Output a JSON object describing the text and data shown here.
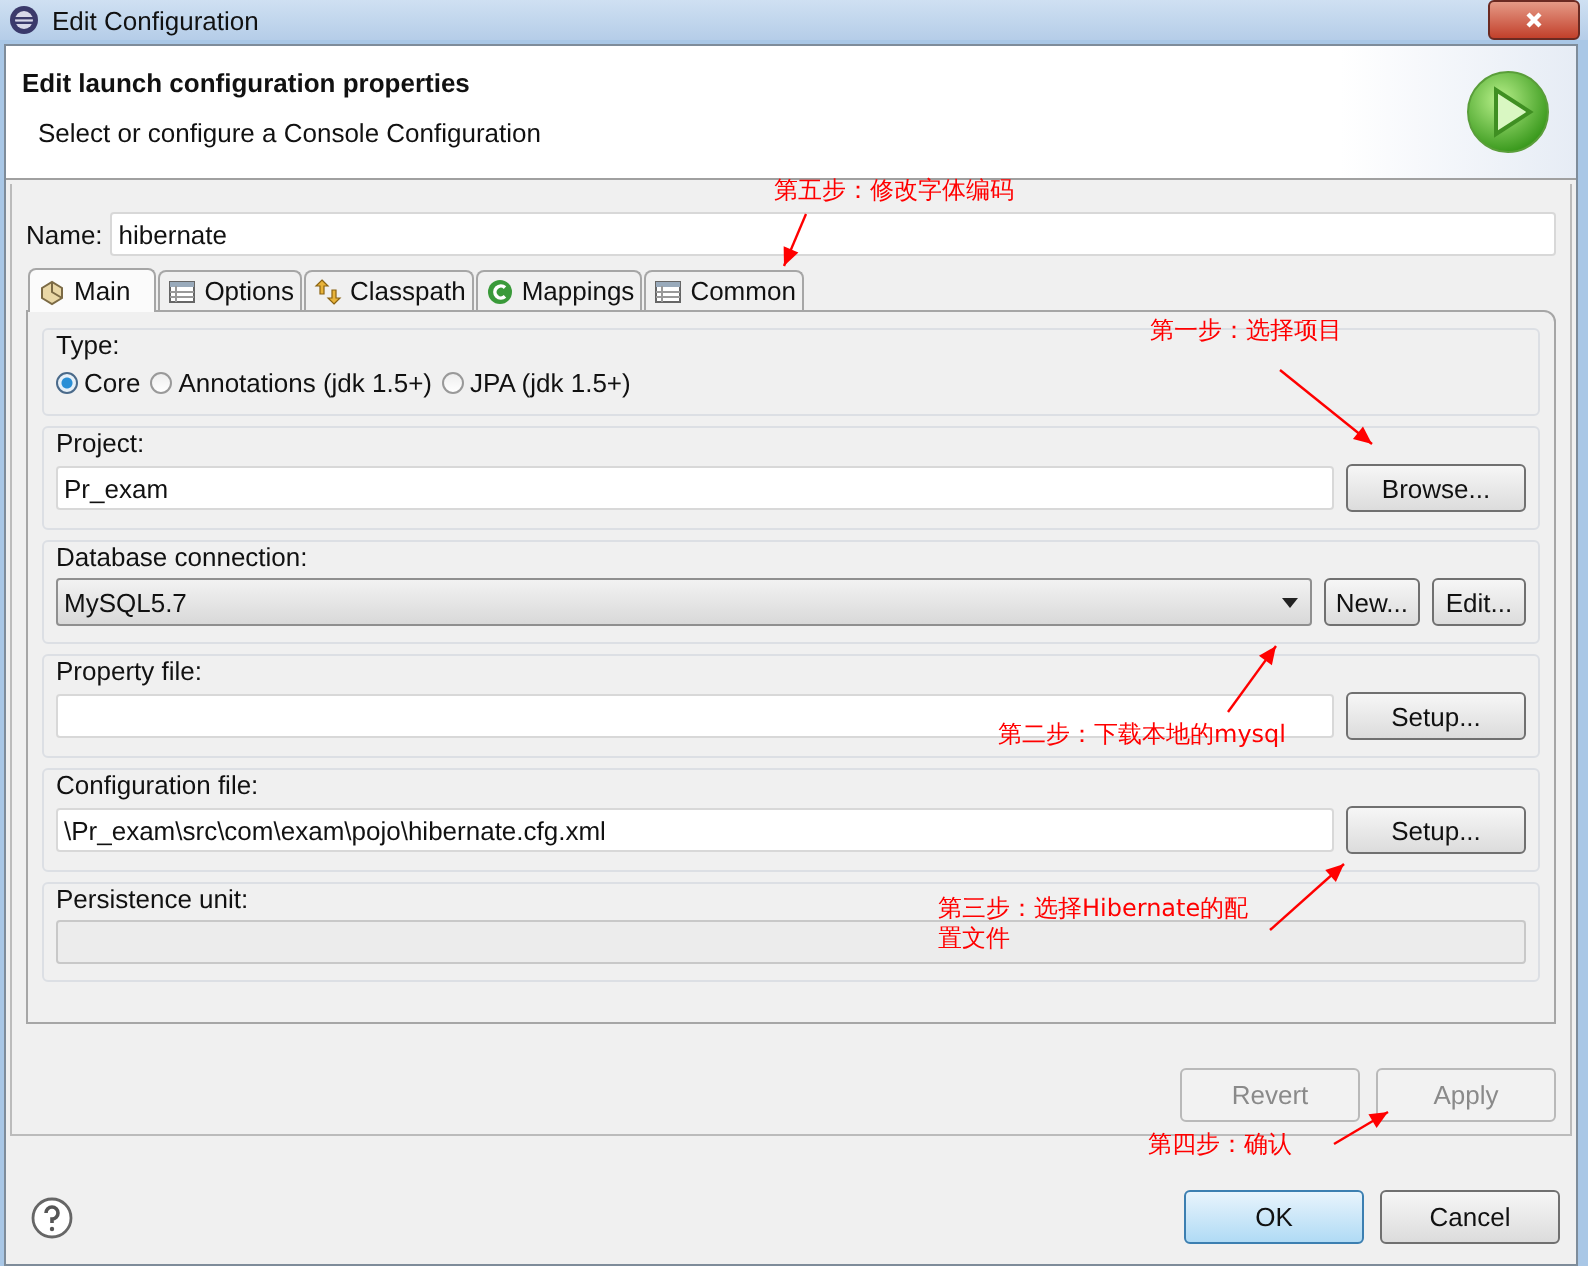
{
  "window": {
    "title": "Edit Configuration"
  },
  "header": {
    "title": "Edit launch configuration properties",
    "subtitle": "Select or configure a Console Configuration"
  },
  "name": {
    "label": "Name:",
    "value": "hibernate"
  },
  "tabs": [
    {
      "label": "Main",
      "kind": "main",
      "selected": true
    },
    {
      "label": "Options",
      "kind": "table",
      "selected": false
    },
    {
      "label": "Classpath",
      "kind": "classpath",
      "selected": false
    },
    {
      "label": "Mappings",
      "kind": "mappings",
      "selected": false
    },
    {
      "label": "Common",
      "kind": "table",
      "selected": false
    }
  ],
  "type_group": {
    "label": "Type:",
    "options": [
      {
        "label": "Core",
        "selected": true
      },
      {
        "label": "Annotations (jdk 1.5+)",
        "selected": false
      },
      {
        "label": "JPA (jdk 1.5+)",
        "selected": false
      }
    ]
  },
  "groups": [
    {
      "kind": "field",
      "label": "Project:",
      "value": "Pr_exam",
      "buttons": [
        "Browse..."
      ]
    },
    {
      "kind": "dropdown",
      "label": "Database connection:",
      "value": "MySQL5.7",
      "buttons": [
        "New...",
        "Edit..."
      ]
    },
    {
      "kind": "field",
      "label": "Property file:",
      "buttons": [
        "Setup..."
      ]
    },
    {
      "kind": "field",
      "label": "Configuration file:",
      "value": "\\Pr_exam\\src\\com\\exam\\pojo\\hibernate.cfg.xml",
      "buttons": [
        "Setup..."
      ]
    },
    {
      "kind": "field",
      "label": "Persistence unit:",
      "disabled": true
    }
  ],
  "panel_buttons": [
    {
      "label": "Revert",
      "disabled": true
    },
    {
      "label": "Apply",
      "disabled": true
    }
  ],
  "dialog_buttons": [
    {
      "label": "OK",
      "default": true
    },
    {
      "label": "Cancel",
      "default": false
    }
  ],
  "annotations": [
    {
      "text": "第五步：修改字体编码"
    },
    {
      "text": "第一步：选择项目"
    },
    {
      "text": "第二步：下载本地的mysql"
    },
    {
      "text": "第三步：选择Hibernate的配置文件"
    },
    {
      "text": "第四步：确认"
    }
  ]
}
